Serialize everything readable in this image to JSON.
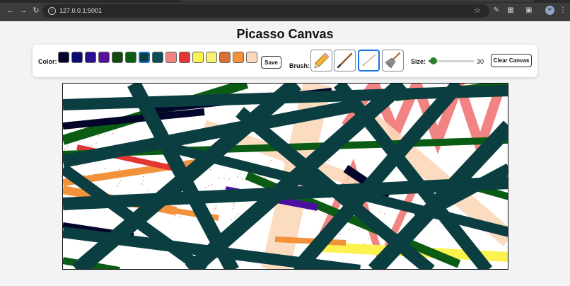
{
  "browser": {
    "url": "127.0.0.1:5001",
    "profile_initial": "P",
    "icons": [
      "back-icon",
      "forward-icon",
      "reload-icon",
      "info-icon",
      "star-icon",
      "pen-icon",
      "extensions-icon",
      "cast-icon",
      "menu-icon"
    ]
  },
  "page": {
    "title": "Picasso Canvas"
  },
  "toolbar": {
    "color_label": "Color:",
    "colors": [
      "#03052b",
      "#0b0b6e",
      "#2d0f91",
      "#5a0e9c",
      "#0f4a0f",
      "#0a5c14",
      "#0b3e40",
      "#0d4f57",
      "#f18383",
      "#e53434",
      "#fbf250",
      "#f9ef74",
      "#d96f35",
      "#f2923b",
      "#fcd9bb"
    ],
    "selected_color": "#0b3e40",
    "save_label": "Save",
    "brush_label": "Brush:",
    "brushes": [
      "pencil",
      "stick",
      "marker",
      "broom"
    ],
    "selected_brush": "marker",
    "size_label": "Size:",
    "size_value": "30",
    "size_fraction": 0.1,
    "clear_label": "Clear Canvas"
  }
}
